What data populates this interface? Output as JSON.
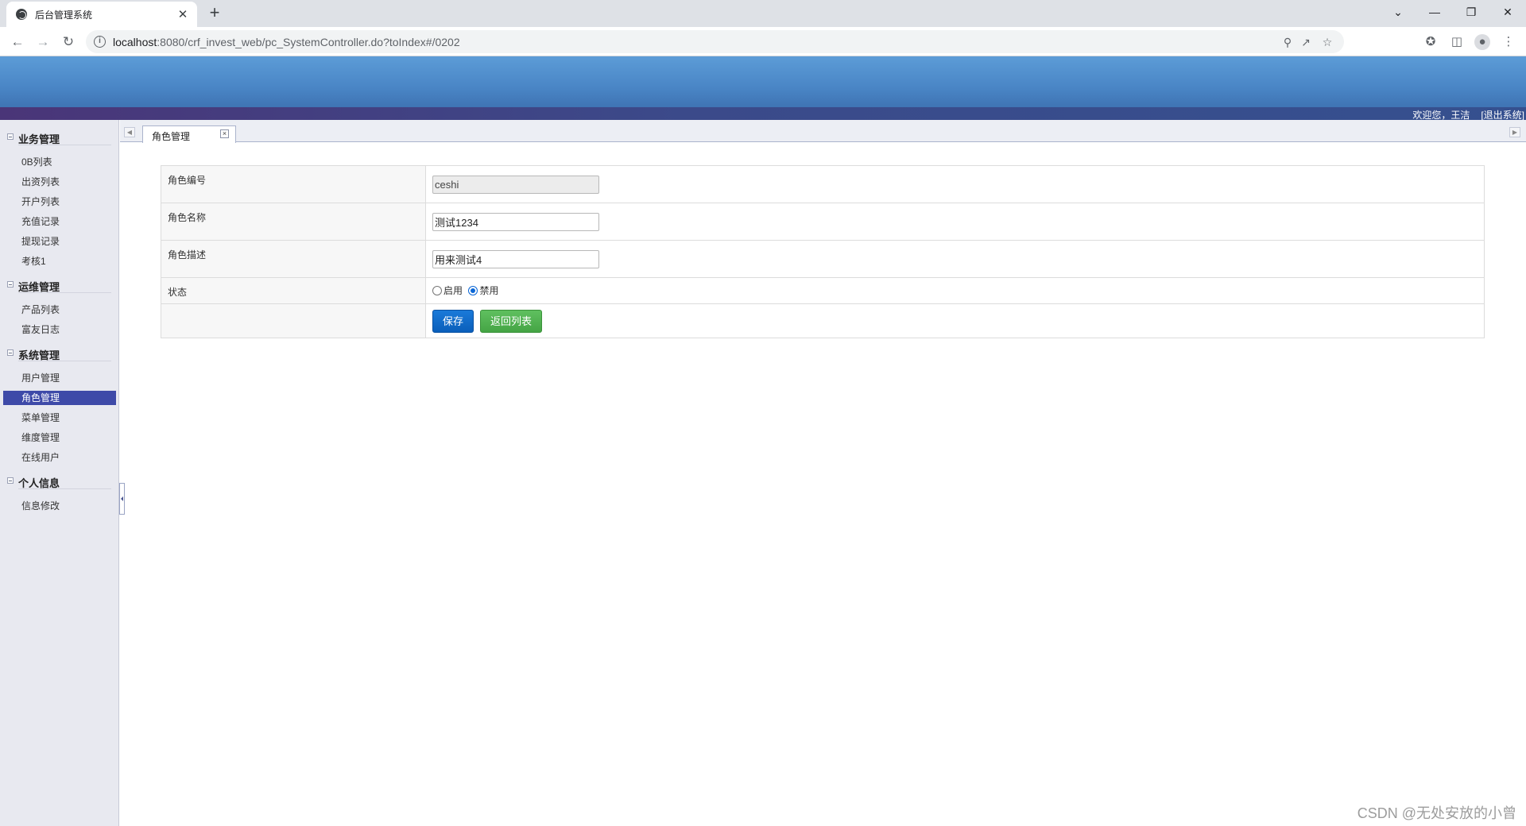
{
  "browser": {
    "tab_title": "后台管理系统",
    "tab_close": "✕",
    "new_tab": "+",
    "url_host": "localhost",
    "url_rest": ":8080/crf_invest_web/pc_SystemController.do?toIndex#/0202",
    "window_controls": [
      "⌄",
      "—",
      "❐",
      "✕"
    ]
  },
  "header": {
    "welcome": "欢迎您，王洁",
    "logout": "[退出系统]"
  },
  "sidebar": {
    "groups": [
      {
        "label": "业务管理",
        "items": [
          "0B列表",
          "出资列表",
          "开户列表",
          "充值记录",
          "提现记录",
          "考核1"
        ]
      },
      {
        "label": "运维管理",
        "items": [
          "产品列表",
          "富友日志"
        ]
      },
      {
        "label": "系统管理",
        "items": [
          "用户管理",
          "角色管理",
          "菜单管理",
          "维度管理",
          "在线用户"
        ]
      },
      {
        "label": "个人信息",
        "items": [
          "信息修改"
        ]
      }
    ],
    "active_item": "角色管理"
  },
  "content_tabs": {
    "active_tab": "角色管理",
    "close_glyph": "×"
  },
  "form": {
    "role_code_label": "角色编号",
    "role_code_value": "ceshi",
    "role_name_label": "角色名称",
    "role_name_value": "测试1234",
    "role_desc_label": "角色描述",
    "role_desc_value": "用来测试4",
    "status_label": "状态",
    "status_options": [
      "启用",
      "禁用"
    ],
    "status_selected": "禁用",
    "save_label": "保存",
    "back_label": "返回列表"
  },
  "watermark": "CSDN @无处安放的小曾"
}
